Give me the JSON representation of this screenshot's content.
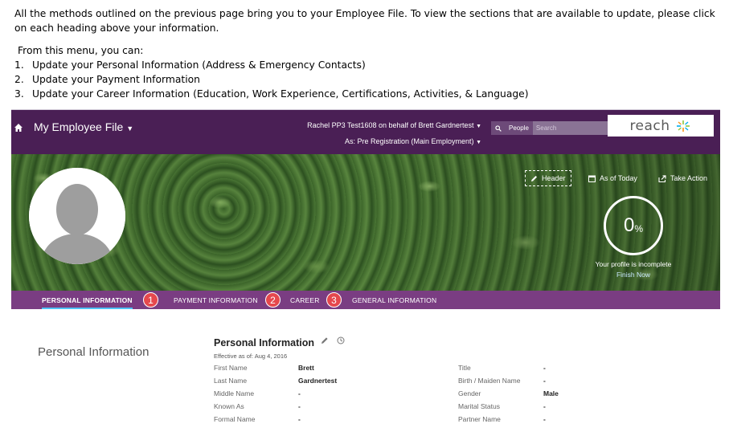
{
  "instructions": {
    "paragraph": "All the methods outlined on the previous page bring you to your Employee File. To view the sections that are available to update, please click on each heading above your information.",
    "menu_intro": "From this menu, you can:",
    "steps": [
      {
        "num": "1.",
        "text": "Update your Personal Information (Address & Emergency Contacts)"
      },
      {
        "num": "2.",
        "text": "Update your Payment Information"
      },
      {
        "num": "3.",
        "text": "Update your Career Information (Education, Work Experience, Certifications, Activities, & Language)"
      }
    ]
  },
  "topbar": {
    "app_title": "My Employee File",
    "user_line": "Rachel PP3 Test1608 on behalf of Brett Gardnertest",
    "as_line": "As: Pre Registration (Main Employment)",
    "search_scope": "People",
    "search_placeholder": "Search",
    "logo_text": "reach"
  },
  "banner": {
    "header_button": "Header",
    "as_of_button": "As of Today",
    "take_action_button": "Take Action",
    "progress_percent": "0",
    "progress_symbol": "%",
    "profile_message": "Your profile is incomplete",
    "finish_link": "Finish Now"
  },
  "tabs": [
    {
      "label": "PERSONAL INFORMATION",
      "badge": "1"
    },
    {
      "label": "PAYMENT INFORMATION",
      "badge": "2"
    },
    {
      "label": "CAREER",
      "badge": "3"
    },
    {
      "label": "GENERAL INFORMATION"
    }
  ],
  "personal": {
    "section_title": "Personal Information",
    "card_title": "Personal Information",
    "effective": "Effective as of: Aug 4, 2016",
    "left_fields": [
      {
        "label": "First Name",
        "value": "Brett"
      },
      {
        "label": "Last Name",
        "value": "Gardnertest"
      },
      {
        "label": "Middle Name",
        "value": "-"
      },
      {
        "label": "Known As",
        "value": "-"
      },
      {
        "label": "Formal Name",
        "value": "-"
      }
    ],
    "right_fields": [
      {
        "label": "Title",
        "value": "-"
      },
      {
        "label": "Birth / Maiden Name",
        "value": "-"
      },
      {
        "label": "Gender",
        "value": "Male"
      },
      {
        "label": "Marital Status",
        "value": "-"
      },
      {
        "label": "Partner Name",
        "value": "-"
      }
    ]
  },
  "colors": {
    "topbar": "#4a1f55",
    "tabbar": "#7a3d82",
    "active_underline": "#4fc3f7",
    "badge": "#e5484d"
  }
}
